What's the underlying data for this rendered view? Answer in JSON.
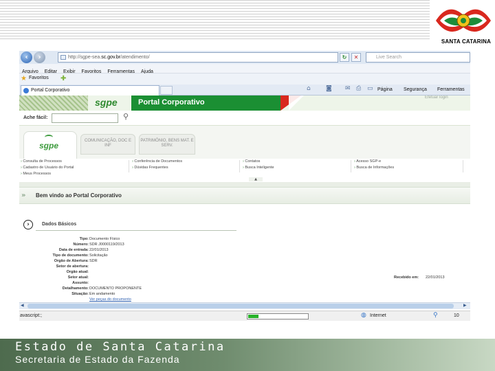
{
  "slide": {
    "logo_text": "SANTA CATARINA",
    "footer_line1": "Estado de Santa Catarina",
    "footer_line2": "Secretaria de Estado da Fazenda"
  },
  "browser": {
    "url_prefix": "http://sgpe-sea.",
    "url_domain": "sc.gov.br",
    "url_suffix": "/atendimento/",
    "search_placeholder": "Live Search",
    "menu": [
      "Arquivo",
      "Editar",
      "Exibir",
      "Favoritos",
      "Ferramentas",
      "Ajuda"
    ],
    "favorites_label": "Favoritos",
    "tab_title": "Portal Corporativo",
    "toolbar": {
      "page": "Página",
      "security": "Segurança",
      "tools": "Ferramentas"
    },
    "status_text": "avascript:;",
    "status_zone": "Internet",
    "zoom": "10",
    "progress_fraction": 0.18
  },
  "portal": {
    "brand": "sgpe",
    "banner_title": "Portal Corporativo",
    "login_text": "Efetuar login",
    "search_label": "Ache fácil:",
    "tabs": [
      {
        "label": "sgpe"
      },
      {
        "label": "COMUNICAÇÃO, DOC E INF"
      },
      {
        "label": "PATRIMÔNIO, BENS MAT. E SERV."
      }
    ],
    "links": [
      "Consulta de Processos",
      "Cadastro de Usuário do Portal",
      "Meus Processos",
      "Conferência de Documentos",
      "Dúvidas Frequentes",
      "Contatos",
      "Busca Inteligente",
      "Acesso SGP-e",
      "Busca de Informações"
    ],
    "welcome": "Bem vindo ao Portal Corporativo",
    "section_title": "Dados Básicos",
    "fields": [
      {
        "label": "Tipo:",
        "value": "Documento Físico"
      },
      {
        "label": "Número:",
        "value": "SDR    J0000119/2013"
      },
      {
        "label": "Data de entrada:",
        "value": "22/01/2013"
      },
      {
        "label": "Tipo de documento:",
        "value": "Solicitação"
      },
      {
        "label": "Orgão de Abertura:",
        "value": "SDR"
      },
      {
        "label": "Setor de abertura:",
        "value": ""
      },
      {
        "label": "Orgão atual:",
        "value": ""
      },
      {
        "label": "Setor atual:",
        "value": ""
      },
      {
        "label": "Assunto:",
        "value": ""
      },
      {
        "label": "Detalhamento:",
        "value": "DOCUMENTO PROPONENTE"
      },
      {
        "label": "Situação:",
        "value": "Em andamento"
      }
    ],
    "pieces_link": "Ver peças do documento",
    "received_label": "Recebido em:",
    "received_value": "22/01/2013"
  }
}
